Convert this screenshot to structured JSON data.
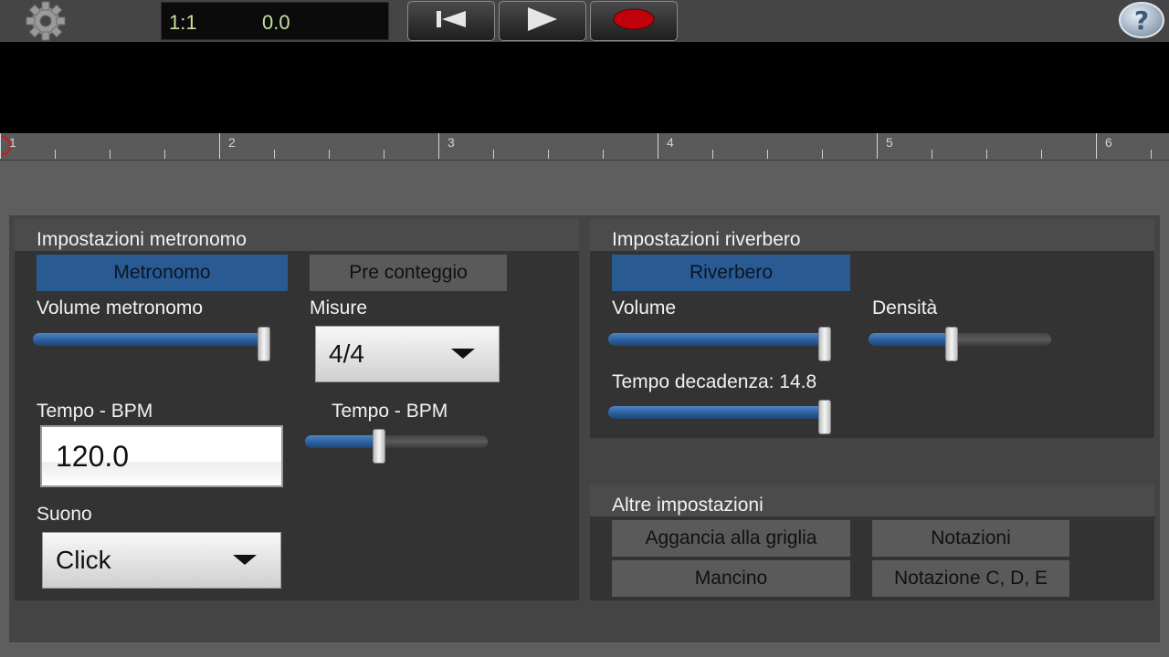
{
  "transport": {
    "position": "1:1",
    "time": "0.0"
  },
  "ruler": {
    "marks": [
      "1",
      "2",
      "3",
      "4",
      "5",
      "6"
    ]
  },
  "metronome": {
    "title": "Impostazioni metronomo",
    "metronome_toggle": "Metronomo",
    "precount_toggle": "Pre conteggio",
    "volume_label": "Volume metronomo",
    "volume_level": 1.0,
    "measures_label": "Misure",
    "measures_value": "4/4",
    "tempo_label": "Tempo - BPM",
    "tempo_value": "120.0",
    "tempo_slider_label": "Tempo - BPM",
    "tempo_slider_level": 0.4,
    "sound_label": "Suono",
    "sound_value": "Click"
  },
  "reverb": {
    "title": "Impostazioni riverbero",
    "toggle": "Riverbero",
    "volume_label": "Volume",
    "volume_level": 1.0,
    "density_label": "Densità",
    "density_level": 0.45,
    "decay_label": "Tempo decadenza: 14.8",
    "decay_level": 1.0
  },
  "other": {
    "title": "Altre impostazioni",
    "snap": "Aggancia alla griglia",
    "notations": "Notazioni",
    "lefthand": "Mancino",
    "notation_cde": "Notazione C, D, E"
  },
  "colors": {
    "accent_on": "#2a5a92",
    "record": "#c0000a"
  },
  "icons": [
    "gear-icon",
    "skip-to-start-icon",
    "play-icon",
    "record-icon",
    "help-icon"
  ]
}
